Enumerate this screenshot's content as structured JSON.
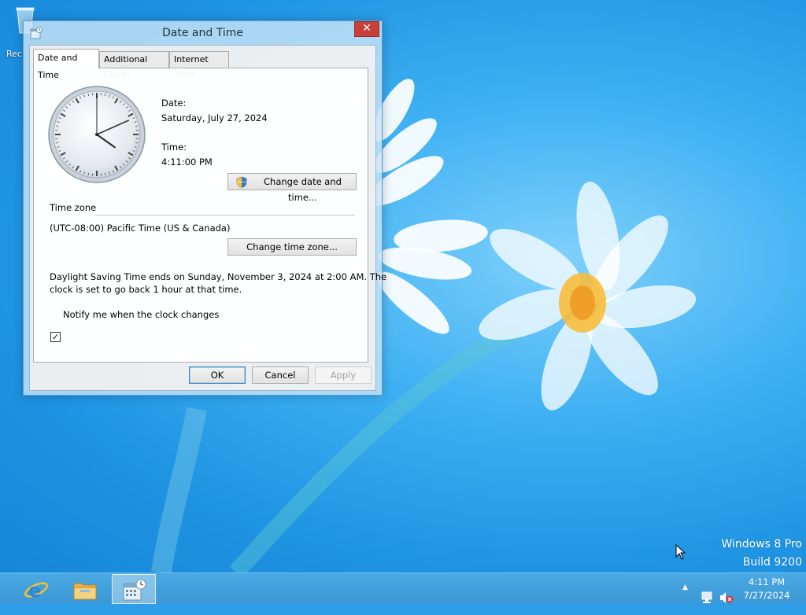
{
  "desktop": {
    "recycle_bin_label": "Rec",
    "watermark_line1": "Windows 8 Pro",
    "watermark_line2": "Build 9200"
  },
  "dialog": {
    "title": "Date and Time",
    "close_label": "✕",
    "tabs": [
      {
        "label": "Date and Time",
        "selected": true
      },
      {
        "label": "Additional Clocks",
        "selected": false
      },
      {
        "label": "Internet Time",
        "selected": false
      }
    ],
    "date_label": "Date:",
    "date_value": "Saturday, July 27, 2024",
    "time_label": "Time:",
    "time_value": "4:11:00 PM",
    "change_datetime_button": "Change date and time...",
    "timezone_header": "Time zone",
    "timezone_value": "(UTC-08:00) Pacific Time (US & Canada)",
    "change_timezone_button": "Change time zone...",
    "dst_line1": "Daylight Saving Time ends on Sunday, November 3, 2024 at 2:00 AM. The",
    "dst_line2": "clock is set to go back 1 hour at that time.",
    "notify_checkbox_label": "Notify me when the clock changes",
    "notify_checked": true,
    "ok_button": "OK",
    "cancel_button": "Cancel",
    "apply_button": "Apply",
    "apply_enabled": false
  },
  "analog_clock": {
    "hour": 4,
    "minute": 11,
    "second": 0
  },
  "taskbar": {
    "items": [
      "internet-explorer-icon",
      "file-explorer-icon",
      "date-time-control-panel-icon"
    ],
    "active_item": "date-time-control-panel-icon",
    "tray_clock_time": "4:11 PM",
    "tray_clock_date": "7/27/2024",
    "tray_chevron": "▲"
  },
  "colors": {
    "desktop_blue": "#2f9ee8",
    "close_red": "#c7403a",
    "taskbar": "#3c98d6"
  }
}
